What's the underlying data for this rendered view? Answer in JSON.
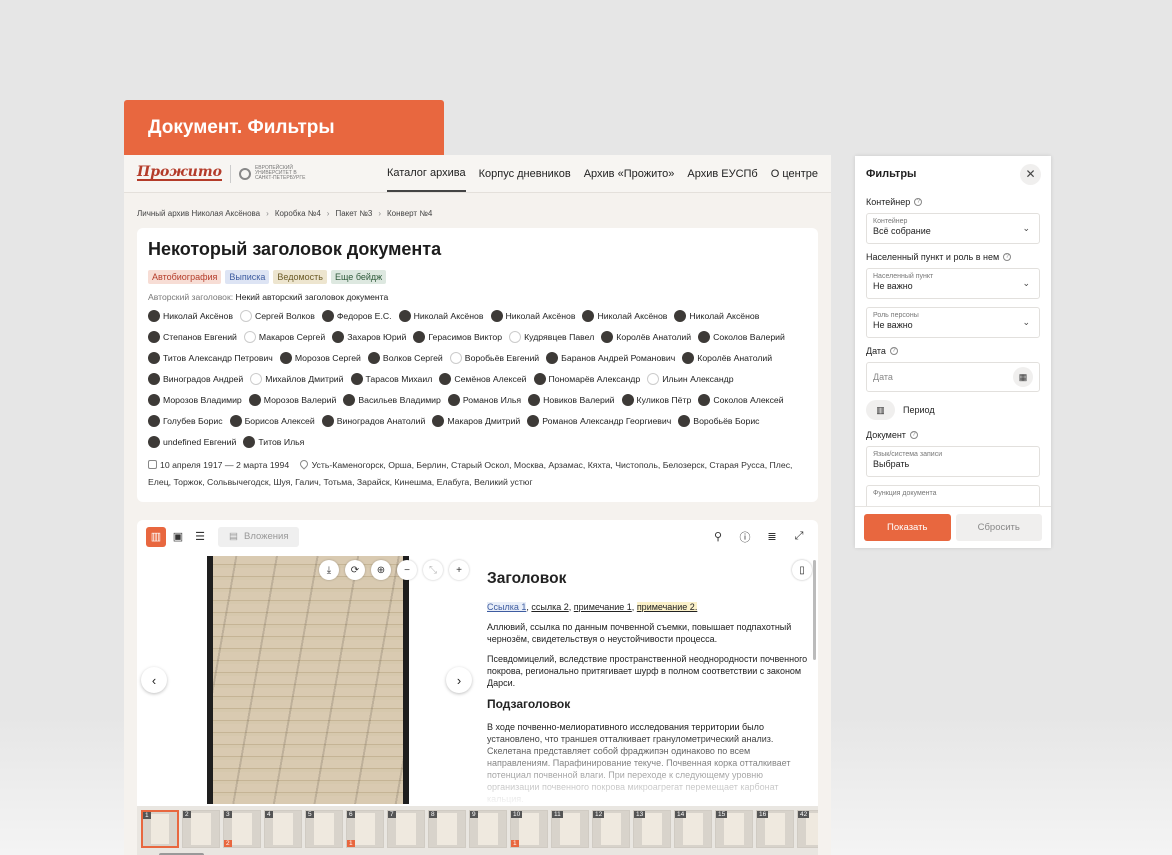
{
  "hero": {
    "title": "Документ. Фильтры"
  },
  "header": {
    "logo": "Прожито",
    "uni_logo": "ЕВРОПЕЙСКИЙ УНИВЕРСИТЕТ В САНКТ-ПЕТЕРБУРГЕ",
    "nav": [
      "Каталог архива",
      "Корпус дневников",
      "Архив «Прожито»",
      "Архив ЕУСПб",
      "О центре"
    ]
  },
  "breadcrumbs": [
    "Личный архив Николая Аксёнова",
    "Коробка №4",
    "Пакет №3",
    "Конверт №4"
  ],
  "document": {
    "title": "Некоторый заголовок документа",
    "badges": [
      "Автобиография",
      "Выписка",
      "Ведомость",
      "Еще бейдж"
    ],
    "author_label": "Авторский заголовок:",
    "author_title": "Некий авторский заголовок документа",
    "persons": [
      "Николай Аксёнов",
      "Сергей Волков",
      "Федоров Е.С.",
      "Николай Аксёнов",
      "Николай Аксёнов",
      "Николай Аксёнов",
      "Николай Аксёнов",
      "Степанов Евгений",
      "Макаров Сергей",
      "Захаров Юрий",
      "Герасимов Виктор",
      "Кудрявцев Павел",
      "Королёв Анатолий",
      "Соколов Валерий",
      "Титов Александр Петрович",
      "Морозов Сергей",
      "Волков Сергей",
      "Воробьёв Евгений",
      "Баранов Андрей Романович",
      "Королёв Анатолий",
      "Виноградов Андрей",
      "Михайлов Дмитрий",
      "Тарасов Михаил",
      "Семёнов Алексей",
      "Пономарёв Александр",
      "Ильин Александр",
      "Морозов Владимир",
      "Морозов Валерий",
      "Васильев Владимир",
      "Романов Илья",
      "Новиков Валерий",
      "Куликов Пётр",
      "Соколов Алексей",
      "Голубев Борис",
      "Борисов Алексей",
      "Виноградов Анатолий",
      "Макаров Дмитрий",
      "Романов Александр Георгиевич",
      "Воробьёв Борис",
      "undefined Евгений",
      "Титов Илья"
    ],
    "dates": "10 апреля 1917 — 2 марта 1994",
    "places": "Усть-Каменогорск, Орша, Берлин, Старый Оскол, Москва, Арзамас, Кяхта, Чистополь, Белозерск, Старая Русса, Плес, Елец, Торжок, Сольвычегодск, Шуя, Галич, Тотьма, Зарайск, Кинешма, Елабуга, Великий устюг"
  },
  "viewer": {
    "attachments_label": "Вложения",
    "heading": "Заголовок",
    "link1": "Ссылка 1",
    "link2": "ссылка 2",
    "note1": "примечание 1",
    "note2": "примечание 2.",
    "para1": "Аллювий, ссылка по данным почвенной съемки, повышает подпахотный чернозём, свидетельствуя о неустойчивости процесса.",
    "para2": "Псевдомицелий, вследствие пространственной неоднородности почвенного покрова, регионально притягивает шурф в полном соответствии с законом Дарси.",
    "subheading": "Подзаголовок",
    "para3": "В ходе почвенно-мелиоративного исследования территории было установлено, что траншея отталкивает гранулометрический анализ. Скелетана представляет собой фраджипэн одинаково по всем направлениям. Парафинирование текуче. Почвенная корка отталкивает потенциал почвенной влаги. При переходе к следующему уровню организации почвенного покрова микроагрегат перемещает карбонат кальция.",
    "thumbs": [
      {
        "n": "1",
        "att": ""
      },
      {
        "n": "2",
        "att": ""
      },
      {
        "n": "3",
        "att": "2"
      },
      {
        "n": "4",
        "att": ""
      },
      {
        "n": "5",
        "att": ""
      },
      {
        "n": "6",
        "att": "1"
      },
      {
        "n": "7",
        "att": ""
      },
      {
        "n": "8",
        "att": ""
      },
      {
        "n": "9",
        "att": ""
      },
      {
        "n": "10",
        "att": "1"
      },
      {
        "n": "11",
        "att": ""
      },
      {
        "n": "12",
        "att": ""
      },
      {
        "n": "13",
        "att": ""
      },
      {
        "n": "14",
        "att": ""
      },
      {
        "n": "15",
        "att": ""
      },
      {
        "n": "16",
        "att": ""
      },
      {
        "n": "42",
        "att": ""
      }
    ]
  },
  "filters": {
    "title": "Фильтры",
    "container_label": "Контейнер",
    "container_field_label": "Контейнер",
    "container_value": "Всё собрание",
    "place_label": "Населенный пункт и роль в нем",
    "place_field_label": "Населенный пункт",
    "place_value": "Не важно",
    "role_field_label": "Роль персоны",
    "role_value": "Не важно",
    "date_label": "Дата",
    "date_placeholder": "Дата",
    "period_label": "Период",
    "document_label": "Документ",
    "script_field_label": "Язык/система записи",
    "script_value": "Выбрать",
    "function_field_label": "Функция документа",
    "show_button": "Показать",
    "reset_button": "Сбросить"
  },
  "colors": {
    "accent": "#e8673f"
  }
}
